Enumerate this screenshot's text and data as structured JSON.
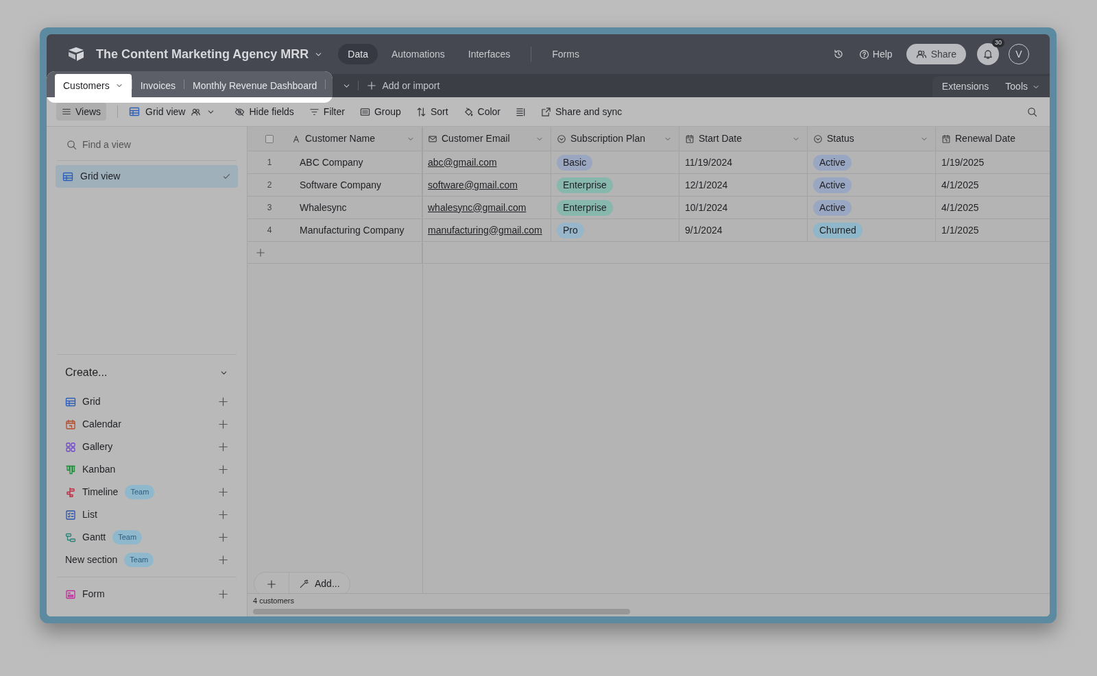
{
  "app": {
    "title": "The Content Marketing Agency MRR"
  },
  "nav": [
    {
      "label": "Data",
      "selected": true
    },
    {
      "label": "Automations",
      "selected": false
    },
    {
      "label": "Interfaces",
      "selected": false
    },
    {
      "label": "Forms",
      "selected": false
    }
  ],
  "header_actions": {
    "help": "Help",
    "share": "Share",
    "notifications": "30",
    "avatar": "V"
  },
  "tables": [
    {
      "label": "Customers",
      "selected": true
    },
    {
      "label": "Invoices",
      "selected": false
    },
    {
      "label": "Monthly Revenue Dashboard",
      "selected": false
    }
  ],
  "add_import": "Add or import",
  "extensions": "Extensions",
  "tools": "Tools",
  "toolbar": {
    "views": "Views",
    "view_name": "Grid view",
    "items": [
      {
        "kind": "hide",
        "label": "Hide fields"
      },
      {
        "kind": "filter",
        "label": "Filter"
      },
      {
        "kind": "group",
        "label": "Group"
      },
      {
        "kind": "sort",
        "label": "Sort"
      },
      {
        "kind": "color",
        "label": "Color"
      },
      {
        "kind": "rowheight"
      },
      {
        "kind": "share",
        "label": "Share and sync"
      }
    ]
  },
  "sidebar": {
    "search_placeholder": "Find a view",
    "views": [
      {
        "label": "Grid view",
        "selected": true
      }
    ],
    "create_heading": "Create...",
    "create_sections": [
      [
        {
          "kind": "grid",
          "label": "Grid"
        },
        {
          "kind": "calendar",
          "label": "Calendar"
        },
        {
          "kind": "gallery",
          "label": "Gallery"
        },
        {
          "kind": "kanban",
          "label": "Kanban"
        },
        {
          "kind": "timeline",
          "label": "Timeline",
          "badge": "Team"
        },
        {
          "kind": "list",
          "label": "List"
        },
        {
          "kind": "gantt",
          "label": "Gantt",
          "badge": "Team"
        },
        {
          "kind": "section",
          "label": "New section",
          "badge": "Team"
        }
      ],
      [
        {
          "kind": "form",
          "label": "Form"
        }
      ]
    ]
  },
  "table": {
    "select_all": {
      "checked": false
    },
    "columns": [
      {
        "kind": "text",
        "label": "Customer Name"
      },
      {
        "kind": "email",
        "label": "Customer Email"
      },
      {
        "kind": "select",
        "label": "Subscription Plan"
      },
      {
        "kind": "date",
        "label": "Start Date"
      },
      {
        "kind": "select",
        "label": "Status"
      },
      {
        "kind": "date",
        "label": "Renewal Date"
      }
    ],
    "rows": [
      {
        "number": "1",
        "name": "ABC Company",
        "email": "abc@gmail.com",
        "plan": {
          "label": "Basic",
          "color": "#9ba7c0"
        },
        "start": "11/19/2024",
        "status": {
          "label": "Active",
          "color": "#9aa7c2"
        },
        "renewal": "1/19/2025"
      },
      {
        "number": "2",
        "name": "Software Company",
        "email": "software@gmail.com",
        "plan": {
          "label": "Enterprise",
          "color": "#88b7ae"
        },
        "start": "12/1/2024",
        "status": {
          "label": "Active",
          "color": "#9aa7c2"
        },
        "renewal": "4/1/2025"
      },
      {
        "number": "3",
        "name": "Whalesync",
        "email": "whalesync@gmail.com",
        "plan": {
          "label": "Enterprise",
          "color": "#88b7ae"
        },
        "start": "10/1/2024",
        "status": {
          "label": "Active",
          "color": "#9aa7c2"
        },
        "renewal": "4/1/2025"
      },
      {
        "number": "4",
        "name": "Manufacturing Company",
        "email": "manufacturing@gmail.com",
        "plan": {
          "label": "Pro",
          "color": "#97b6c9"
        },
        "start": "9/1/2024",
        "status": {
          "label": "Churned",
          "color": "#8fb6c9"
        },
        "renewal": "1/1/2025"
      }
    ]
  },
  "footer": {
    "add": "Add...",
    "count": "4 customers"
  }
}
